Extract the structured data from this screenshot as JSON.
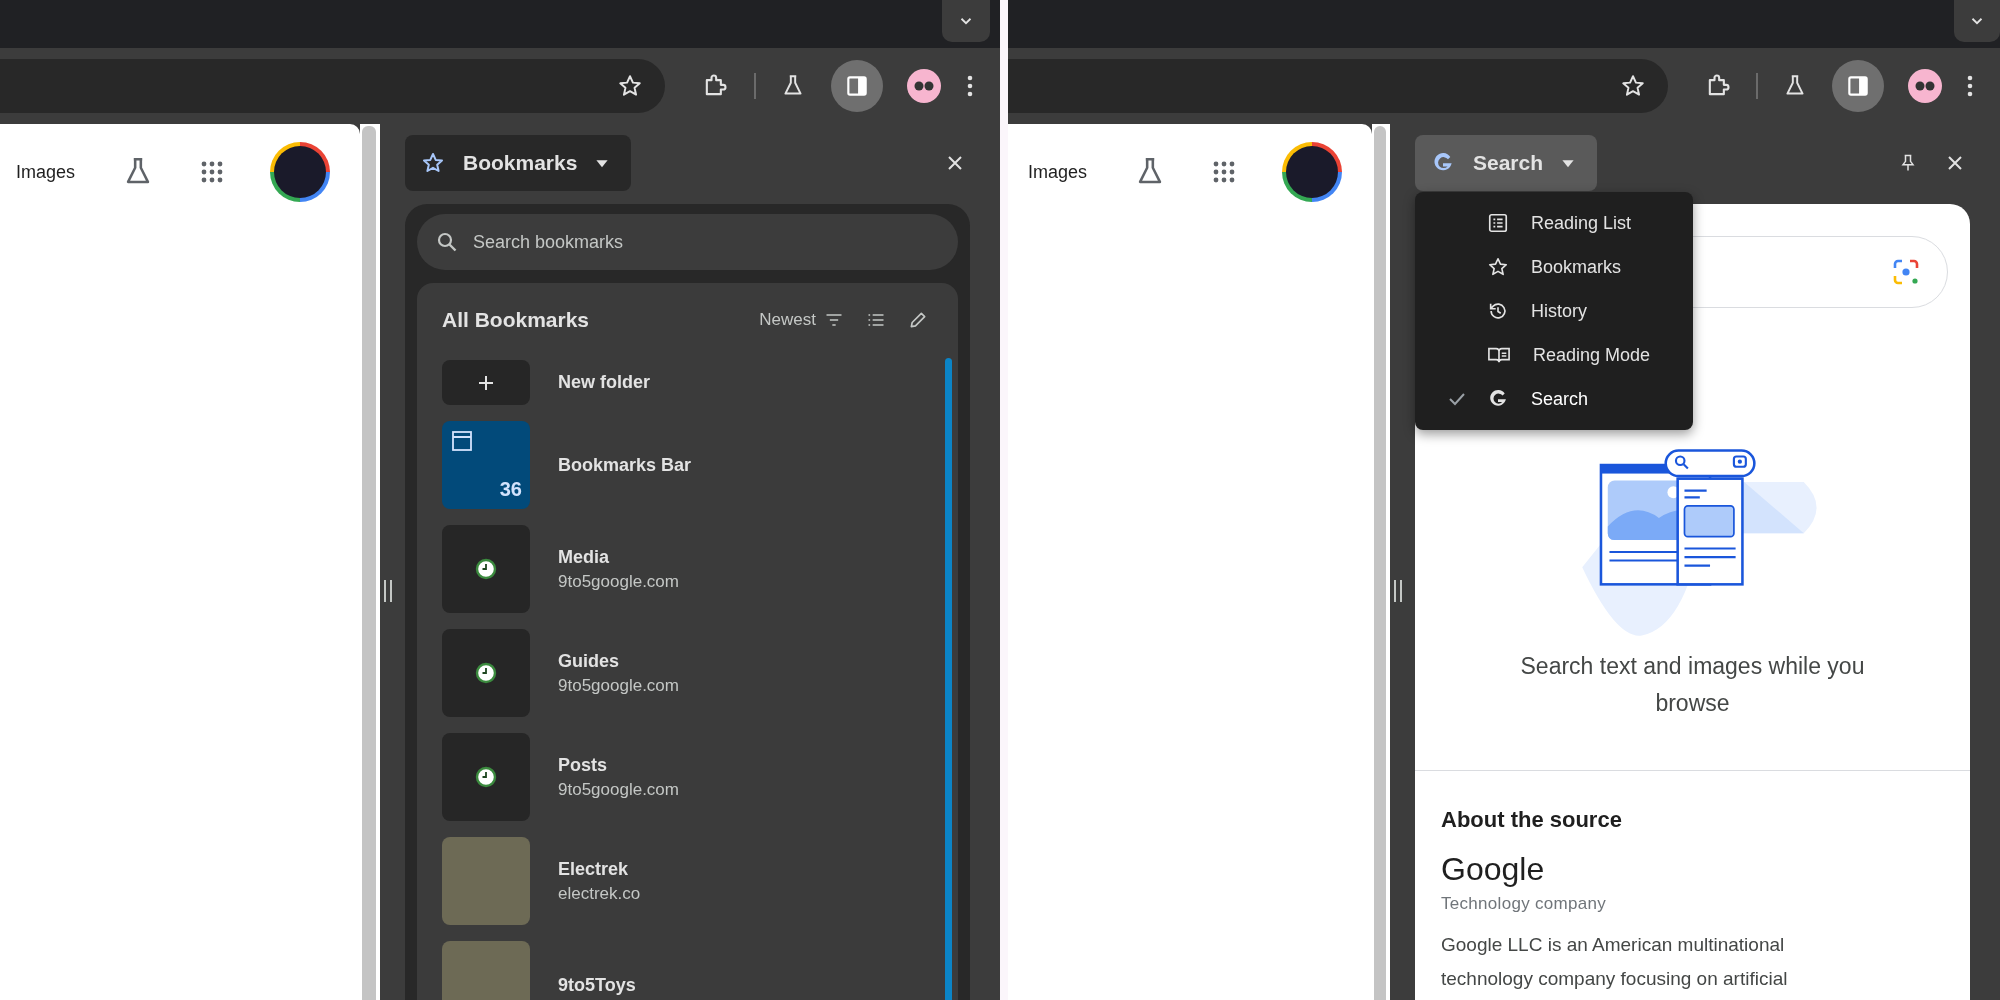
{
  "bookmarks_window": {
    "page": {
      "link": "Images"
    },
    "side_panel": {
      "title": "Bookmarks",
      "search": {
        "placeholder": "Search bookmarks"
      },
      "heading": "All Bookmarks",
      "sort": "Newest",
      "items": [
        {
          "kind": "add",
          "title": "New folder"
        },
        {
          "kind": "folder",
          "title": "Bookmarks Bar",
          "count": "36"
        },
        {
          "kind": "page",
          "title": "Media",
          "url": "9to5google.com"
        },
        {
          "kind": "page",
          "title": "Guides",
          "url": "9to5google.com"
        },
        {
          "kind": "page",
          "title": "Posts",
          "url": "9to5google.com"
        },
        {
          "kind": "photo",
          "title": "Electrek",
          "url": "electrek.co"
        },
        {
          "kind": "photo",
          "title": "9to5Toys"
        }
      ]
    }
  },
  "search_window": {
    "page": {
      "link": "Images"
    },
    "side_panel": {
      "title": "Search",
      "menu": [
        {
          "kind": "reading_list",
          "label": "Reading List",
          "selected": false
        },
        {
          "kind": "bookmarks",
          "label": "Bookmarks",
          "selected": false
        },
        {
          "kind": "history",
          "label": "History",
          "selected": false
        },
        {
          "kind": "reading_mode",
          "label": "Reading Mode",
          "selected": false
        },
        {
          "kind": "search",
          "label": "Search",
          "selected": true
        }
      ],
      "tagline": "Search text and images while you browse",
      "about": {
        "heading": "About the source",
        "name": "Google",
        "subtitle": "Technology company",
        "description": "Google LLC is an American multinational technology company focusing on artificial"
      }
    }
  }
}
